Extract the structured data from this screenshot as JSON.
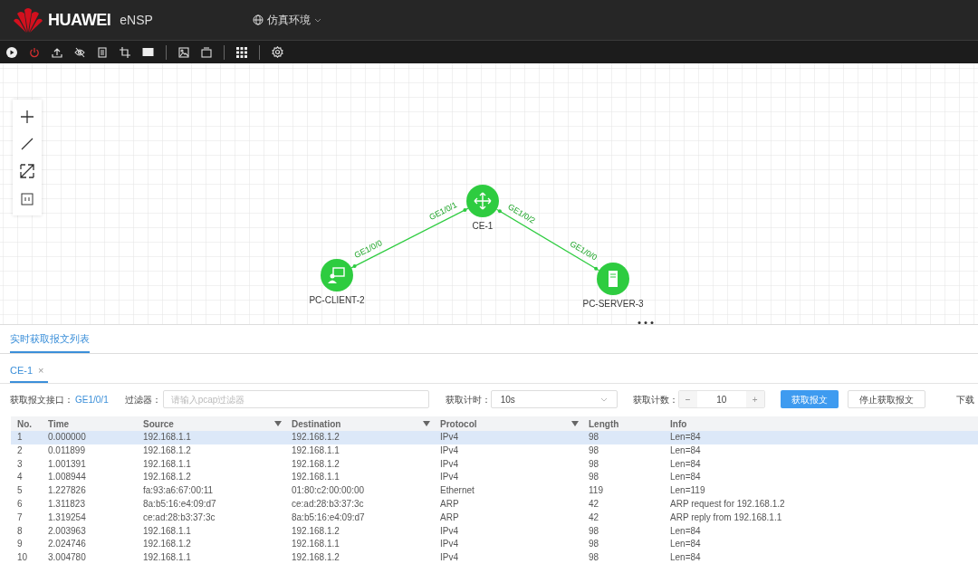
{
  "header": {
    "brand": "HUAWEI",
    "product": "eNSP",
    "environment": "仿真环境"
  },
  "topology": {
    "nodes": [
      {
        "label": "CE-1",
        "kind": "switch"
      },
      {
        "label": "PC-CLIENT-2",
        "kind": "client"
      },
      {
        "label": "PC-SERVER-3",
        "kind": "server"
      }
    ],
    "links": [
      {
        "ports": [
          "GE1/0/0",
          "GE1/0/1"
        ]
      },
      {
        "ports": [
          "GE1/0/2",
          "GE1/0/0"
        ]
      }
    ]
  },
  "panel": {
    "title": "实时获取报文列表",
    "tabs": [
      {
        "label": "CE-1",
        "close": "×",
        "selected": true
      }
    ],
    "controls": {
      "interface_label": "获取报文接口：",
      "interface": "GE1/0/1",
      "filter_label": "过滤器：",
      "filter_placeholder": "请输入pcap过滤器",
      "timer_label": "获取计时：",
      "timer": "10s",
      "count_label": "获取计数：",
      "count_minus": "−",
      "count": "10",
      "count_plus": "+",
      "buttons": [
        {
          "label": "获取报文",
          "kind": "primary"
        },
        {
          "label": "停止获取报文",
          "kind": "default"
        },
        {
          "label": "下载",
          "kind": "text"
        }
      ]
    },
    "table": {
      "columns": [
        {
          "label": "No.",
          "filter": false
        },
        {
          "label": "Time",
          "filter": false
        },
        {
          "label": "Source",
          "filter": true
        },
        {
          "label": "Destination",
          "filter": true
        },
        {
          "label": "Protocol",
          "filter": true
        },
        {
          "label": "Length",
          "filter": false
        },
        {
          "label": "Info",
          "filter": false
        }
      ],
      "rows": [
        {
          "cells": [
            "1",
            "0.000000",
            "192.168.1.1",
            "192.168.1.2",
            "IPv4",
            "98",
            "Len=84"
          ],
          "selected": true
        },
        {
          "cells": [
            "2",
            "0.011899",
            "192.168.1.2",
            "192.168.1.1",
            "IPv4",
            "98",
            "Len=84"
          ],
          "selected": false
        },
        {
          "cells": [
            "3",
            "1.001391",
            "192.168.1.1",
            "192.168.1.2",
            "IPv4",
            "98",
            "Len=84"
          ],
          "selected": false
        },
        {
          "cells": [
            "4",
            "1.008944",
            "192.168.1.2",
            "192.168.1.1",
            "IPv4",
            "98",
            "Len=84"
          ],
          "selected": false
        },
        {
          "cells": [
            "5",
            "1.227826",
            "fa:93:a6:67:00:11",
            "01:80:c2:00:00:00",
            "Ethernet",
            "119",
            "Len=119"
          ],
          "selected": false
        },
        {
          "cells": [
            "6",
            "1.311823",
            "8a:b5:16:e4:09:d7",
            "ce:ad:28:b3:37:3c",
            "ARP",
            "42",
            "ARP request for 192.168.1.2"
          ],
          "selected": false
        },
        {
          "cells": [
            "7",
            "1.319254",
            "ce:ad:28:b3:37:3c",
            "8a:b5:16:e4:09:d7",
            "ARP",
            "42",
            "ARP reply from 192.168.1.1"
          ],
          "selected": false
        },
        {
          "cells": [
            "8",
            "2.003963",
            "192.168.1.1",
            "192.168.1.2",
            "IPv4",
            "98",
            "Len=84"
          ],
          "selected": false
        },
        {
          "cells": [
            "9",
            "2.024746",
            "192.168.1.2",
            "192.168.1.1",
            "IPv4",
            "98",
            "Len=84"
          ],
          "selected": false
        },
        {
          "cells": [
            "10",
            "3.004780",
            "192.168.1.1",
            "192.168.1.2",
            "IPv4",
            "98",
            "Len=84"
          ],
          "selected": false
        }
      ]
    }
  }
}
